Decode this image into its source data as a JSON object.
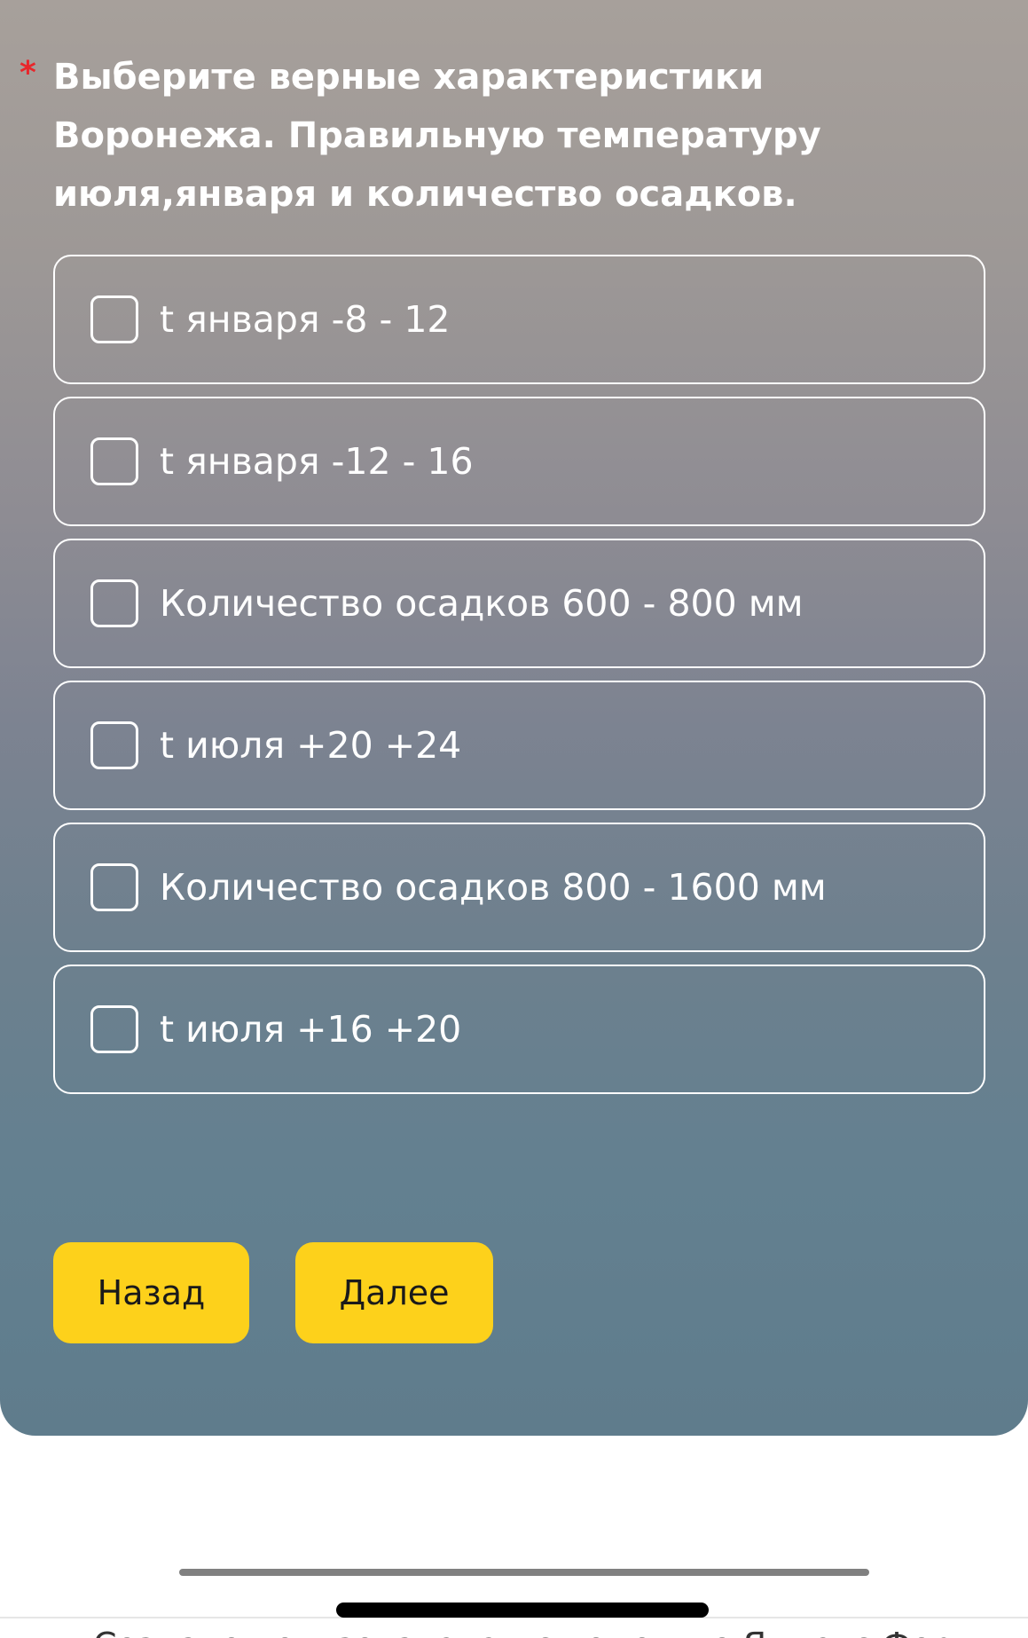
{
  "question": {
    "required_mark": "*",
    "text": "Выберите верные характеристики Воронежа. Правильную температуру июля,января и количество осадков."
  },
  "options": [
    {
      "label": "t января -8 - 12",
      "checked": false
    },
    {
      "label": "t января -12 - 16",
      "checked": false
    },
    {
      "label": "Количество осадков 600 - 800 мм",
      "checked": false
    },
    {
      "label": "t июля +20 +24",
      "checked": false
    },
    {
      "label": "Количество осадков 800 - 1600 мм",
      "checked": false
    },
    {
      "label": "t июля +16 +20",
      "checked": false
    }
  ],
  "buttons": {
    "back_label": "Назад",
    "next_label": "Далее"
  },
  "footer": {
    "text": "Создано пользователем с помощью Яндекс Форм"
  },
  "colors": {
    "button_background": "#fdd11b",
    "required_mark": "#e8262b",
    "option_border": "#ffffff"
  }
}
